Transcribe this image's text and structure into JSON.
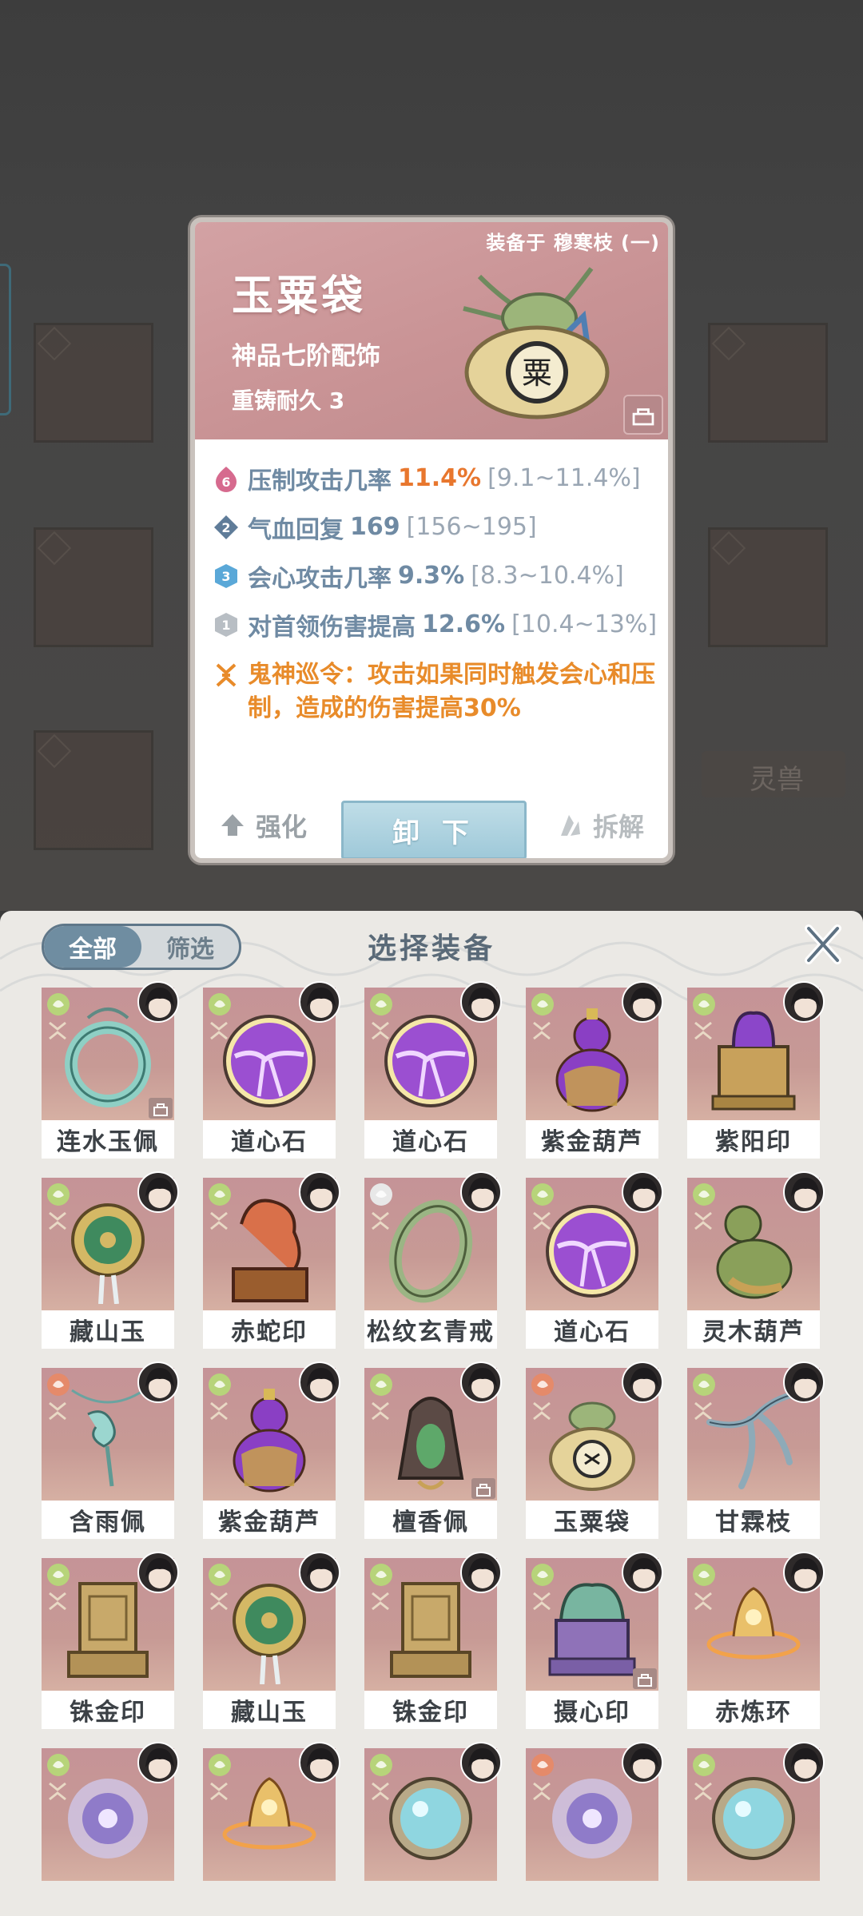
{
  "background": {
    "side_label": "灵兽"
  },
  "popup": {
    "equipped_by": "装备于 穆寒枝 (一)",
    "item_name": "玉粟袋",
    "grade": "神品七阶配饰",
    "durability": "重铸耐久 3",
    "stats": [
      {
        "badge": "6",
        "badge_color": "#d66a8e",
        "label": "压制攻击几率",
        "value": "11.4%",
        "range": "[9.1~11.4%]",
        "highlight": true
      },
      {
        "badge": "2",
        "badge_color": "#5f7c99",
        "label": "气血回复",
        "value": "169",
        "range": "[156~195]",
        "highlight": false
      },
      {
        "badge": "3",
        "badge_color": "#5aa8d8",
        "label": "会心攻击几率",
        "value": "9.3%",
        "range": "[8.3~10.4%]",
        "highlight": false
      },
      {
        "badge": "1",
        "badge_color": "#b8bec4",
        "label": "对首领伤害提高",
        "value": "12.6%",
        "range": "[10.4~13%]",
        "highlight": false
      }
    ],
    "special_text": "鬼神巡令：攻击如果同时触发会心和压制，造成的伤害提高30%",
    "buttons": {
      "enhance": "强化",
      "unequip": "卸 下",
      "dismantle": "拆解"
    }
  },
  "panel": {
    "title": "选择装备",
    "tabs": [
      "全部",
      "筛选"
    ],
    "items": [
      {
        "name": "连水玉佩",
        "art": "jade-ring",
        "locked": true,
        "q": "#b7d47a"
      },
      {
        "name": "道心石",
        "art": "purple-orb",
        "locked": false,
        "q": "#b7d47a"
      },
      {
        "name": "道心石",
        "art": "purple-orb",
        "locked": false,
        "q": "#b7d47a"
      },
      {
        "name": "紫金葫芦",
        "art": "purple-gourd",
        "locked": false,
        "q": "#b7d47a"
      },
      {
        "name": "紫阳印",
        "art": "seal-box",
        "locked": false,
        "q": "#b7d47a"
      },
      {
        "name": "藏山玉",
        "art": "jade-disc",
        "locked": false,
        "q": "#b7d47a"
      },
      {
        "name": "赤蛇印",
        "art": "snake-seal",
        "locked": false,
        "q": "#b7d47a"
      },
      {
        "name": "松纹玄青戒",
        "art": "green-ring",
        "locked": false,
        "q": "#e8e8e8"
      },
      {
        "name": "道心石",
        "art": "purple-orb",
        "locked": false,
        "q": "#b7d47a"
      },
      {
        "name": "灵木葫芦",
        "art": "green-gourd",
        "locked": false,
        "q": "#b7d47a"
      },
      {
        "name": "含雨佩",
        "art": "pendant",
        "locked": false,
        "q": "#e58a6a"
      },
      {
        "name": "紫金葫芦",
        "art": "purple-gourd",
        "locked": false,
        "q": "#b7d47a"
      },
      {
        "name": "檀香佩",
        "art": "incense",
        "locked": true,
        "q": "#b7d47a"
      },
      {
        "name": "玉粟袋",
        "art": "bag",
        "locked": false,
        "q": "#e58a6a"
      },
      {
        "name": "甘霖枝",
        "art": "branch",
        "locked": false,
        "q": "#b7d47a"
      },
      {
        "name": "铢金印",
        "art": "gold-seal",
        "locked": false,
        "q": "#b7d47a"
      },
      {
        "name": "藏山玉",
        "art": "jade-disc",
        "locked": false,
        "q": "#b7d47a"
      },
      {
        "name": "铢金印",
        "art": "gold-seal",
        "locked": false,
        "q": "#b7d47a"
      },
      {
        "name": "摄心印",
        "art": "jade-seal",
        "locked": true,
        "q": "#b7d47a"
      },
      {
        "name": "赤炼环",
        "art": "fire-ring",
        "locked": false,
        "q": "#b7d47a"
      },
      {
        "name": "",
        "art": "purple-vortex",
        "locked": false,
        "q": "#b7d47a"
      },
      {
        "name": "",
        "art": "fire-ring",
        "locked": false,
        "q": "#b7d47a"
      },
      {
        "name": "",
        "art": "mirror",
        "locked": false,
        "q": "#b7d47a"
      },
      {
        "name": "",
        "art": "purple-vortex",
        "locked": false,
        "q": "#e58a6a"
      },
      {
        "name": "",
        "art": "mirror",
        "locked": false,
        "q": "#b7d47a"
      }
    ]
  }
}
